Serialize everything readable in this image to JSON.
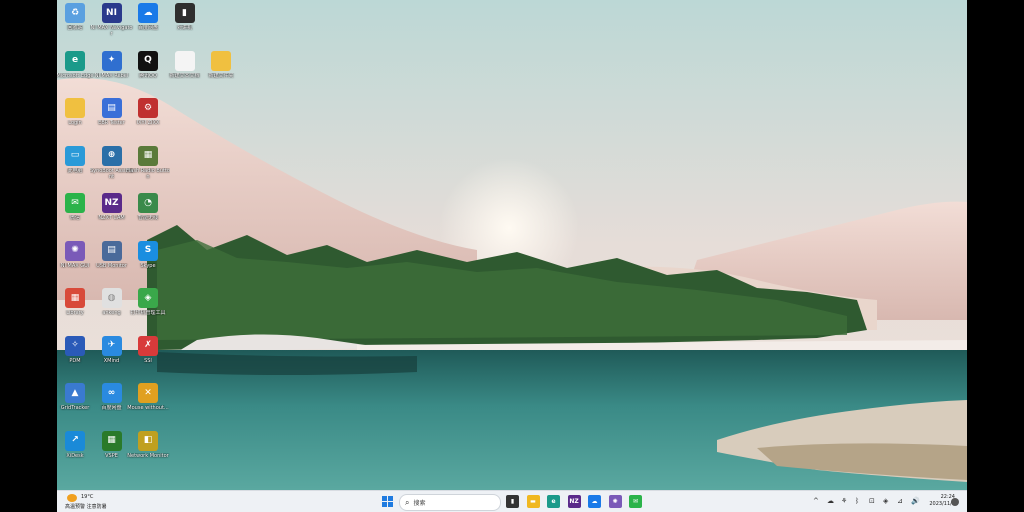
{
  "desktop": {
    "icons": [
      {
        "label": "回收站",
        "glyph": "♻",
        "color": "#5aa0e0"
      },
      {
        "label": "NI MAX Navigator",
        "glyph": "NI",
        "color": "#2a3a8c"
      },
      {
        "label": "百度网盘",
        "glyph": "☁",
        "color": "#1a7ae8"
      },
      {
        "label": "对讲机",
        "glyph": "▮",
        "color": "#2e2e2e"
      },
      {
        "label": "Microsoft Edge",
        "glyph": "e",
        "color": "#1b9a8a"
      },
      {
        "label": "NI MAX Rebel",
        "glyph": "✦",
        "color": "#2f6fd0"
      },
      {
        "label": "腾讯QQ",
        "glyph": "Q",
        "color": "#111111"
      },
      {
        "label": "新建文本文档",
        "glyph": "",
        "color": "#f4f4f4"
      },
      {
        "label": "新建文件夹",
        "glyph": "",
        "color": "#f0c040"
      },
      {
        "label": "Login",
        "glyph": "",
        "color": "#f0c040"
      },
      {
        "label": "EBR Tester",
        "glyph": "▤",
        "color": "#3a6fd8"
      },
      {
        "label": "IXYI ZIXX",
        "glyph": "⚙",
        "color": "#c03030"
      },
      {
        "label": "此电脑",
        "glyph": "▭",
        "color": "#2a9ad8"
      },
      {
        "label": "SynoBoot Assistant",
        "glyph": "⊕",
        "color": "#2a6fa8"
      },
      {
        "label": "Flash Radio Button",
        "glyph": "▦",
        "color": "#5a7a3a"
      },
      {
        "label": "微信",
        "glyph": "✉",
        "color": "#2bb34a"
      },
      {
        "label": "NZXT CAM",
        "glyph": "NZ",
        "color": "#5a2a8a"
      },
      {
        "label": "智能无线",
        "glyph": "◔",
        "color": "#3a8a4a"
      },
      {
        "label": "NI MAX GUI",
        "glyph": "✺",
        "color": "#7a5ab8"
      },
      {
        "label": "USB Monitor",
        "glyph": "▤",
        "color": "#4a6a9a"
      },
      {
        "label": "Skype",
        "glyph": "S",
        "color": "#1a8ee0"
      },
      {
        "label": "Library",
        "glyph": "▦",
        "color": "#d84a3a"
      },
      {
        "label": "ankeng",
        "glyph": "◍",
        "color": "#e0e0e0"
      },
      {
        "label": "打印机管理工具",
        "glyph": "◈",
        "color": "#3aa84a"
      },
      {
        "label": "PDM",
        "glyph": "✧",
        "color": "#2a5ab8"
      },
      {
        "label": "XMind",
        "glyph": "✈",
        "color": "#2a8ae0"
      },
      {
        "label": "SSI",
        "glyph": "✗",
        "color": "#d83a3a"
      },
      {
        "label": "GridTracker",
        "glyph": "▲",
        "color": "#3a7ad0"
      },
      {
        "label": "百度网盘",
        "glyph": "∞",
        "color": "#2a8ae0"
      },
      {
        "label": "Mouse without...",
        "glyph": "✕",
        "color": "#e0a020"
      },
      {
        "label": "XiDesk",
        "glyph": "↗",
        "color": "#1a8ad8"
      },
      {
        "label": "VSPE",
        "glyph": "▦",
        "color": "#2a7a2a"
      },
      {
        "label": "Network Monitor",
        "glyph": "◧",
        "color": "#c0a020"
      }
    ]
  },
  "taskbar": {
    "weather_temp": "19°C",
    "weather_desc": "高温预警 注意防暑",
    "search_placeholder": "搜索",
    "start_icon": "windows-start-icon",
    "apps": [
      {
        "name": "task-view-icon",
        "color": "#333333",
        "glyph": "▮"
      },
      {
        "name": "file-explorer-icon",
        "color": "#f0b820",
        "glyph": "▬"
      },
      {
        "name": "edge-icon",
        "color": "#1b9a8a",
        "glyph": "e"
      },
      {
        "name": "nzxt-icon",
        "color": "#5a2a8a",
        "glyph": "NZ"
      },
      {
        "name": "baidu-netdisk-icon",
        "color": "#1a7ae8",
        "glyph": "☁"
      },
      {
        "name": "ni-max-icon",
        "color": "#7a5ab8",
        "glyph": "✺"
      },
      {
        "name": "wechat-icon",
        "color": "#2bb34a",
        "glyph": "✉"
      }
    ],
    "tray": [
      "^",
      "☁",
      "⚘",
      "ᛒ",
      "⊡",
      "◈",
      "⊿",
      "🔊"
    ],
    "time": "22:24",
    "date": "2023/11/9"
  },
  "colors": {
    "taskbar_bg": "#eef1f5",
    "start_blue": "#1f7be0"
  }
}
